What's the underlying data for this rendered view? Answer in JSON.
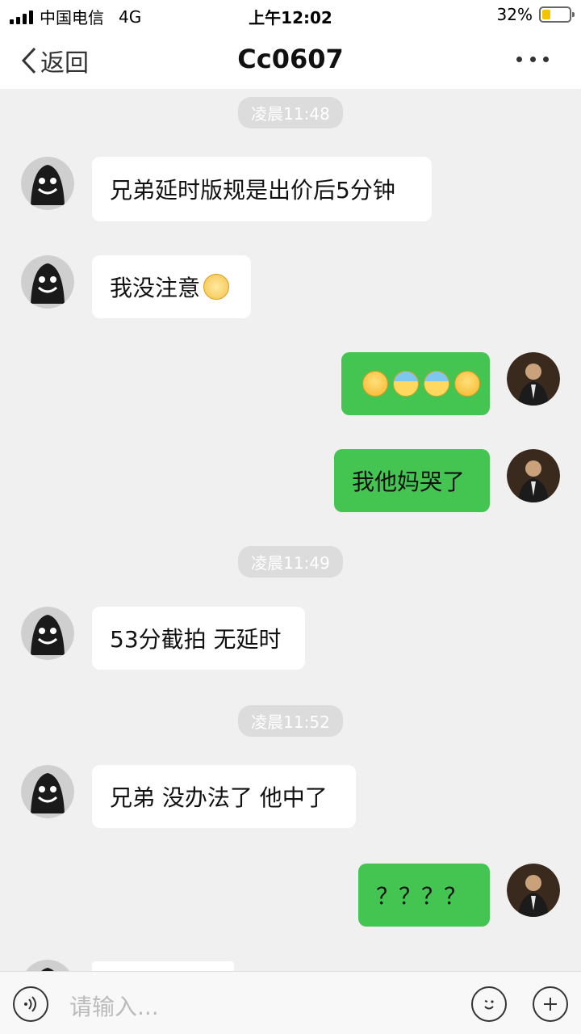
{
  "status_bar": {
    "carrier": "中国电信",
    "network": "4G",
    "time": "上午12:02",
    "battery": "32%",
    "battery_level": 0.32
  },
  "nav": {
    "back_label": "返回",
    "title": "Cc0607"
  },
  "messages": {
    "ts1": "凌晨11:48",
    "m1": "兄弟延时版规是出价后5分钟",
    "m2": "我没注意",
    "m4": "我他妈哭了",
    "ts2": "凌晨11:49",
    "m5": "53分截拍 无延时",
    "ts3": "凌晨11:52",
    "m6": "兄弟 没办法了 他中了",
    "m7": "？？？？"
  },
  "input": {
    "placeholder": "请输入..."
  },
  "colors": {
    "outgoing_bubble": "#44c552",
    "incoming_bubble": "#ffffff",
    "chat_bg": "#f0f0f0"
  },
  "icons": {
    "voice": "voice-icon",
    "emoji": "emoji-icon",
    "plus": "plus-icon"
  }
}
